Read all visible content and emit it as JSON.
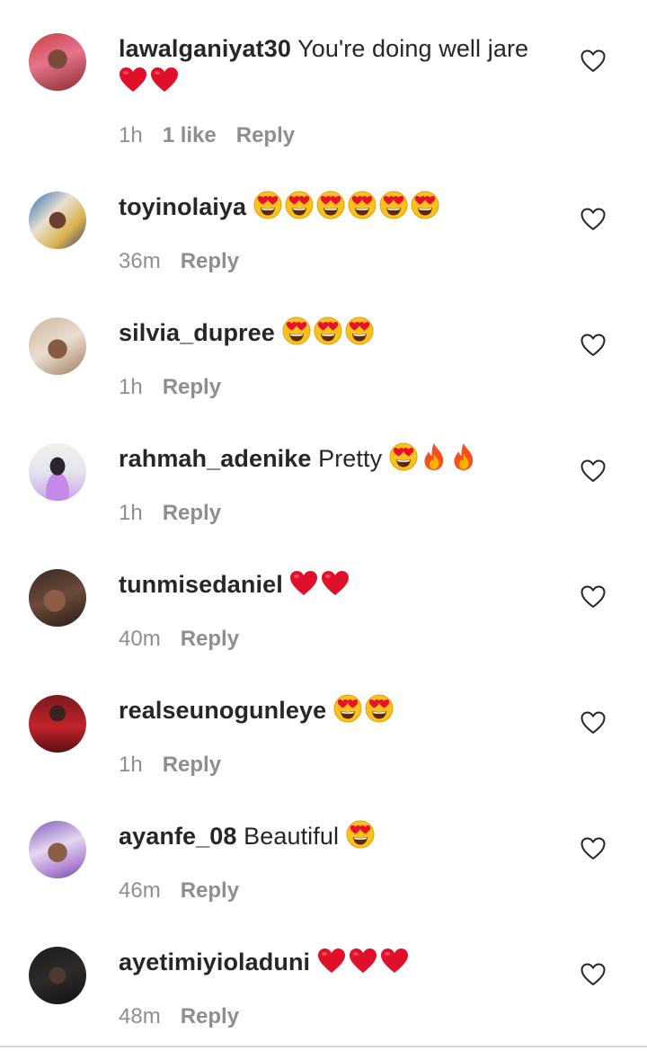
{
  "colors": {
    "text": "#262626",
    "meta": "#8e8e8e",
    "heart": "#e0102a"
  },
  "comments": [
    {
      "username": "lawalganiyat30",
      "text": "You're doing well jare",
      "emojis": [
        "red-heart",
        "red-heart"
      ],
      "time": "1h",
      "likes": "1 like",
      "reply": "Reply"
    },
    {
      "username": "toyinolaiya",
      "text": "",
      "emojis": [
        "heart-eyes",
        "heart-eyes",
        "heart-eyes",
        "heart-eyes",
        "heart-eyes",
        "heart-eyes"
      ],
      "time": "36m",
      "reply": "Reply"
    },
    {
      "username": "silvia_dupree",
      "text": "",
      "emojis": [
        "heart-eyes",
        "heart-eyes",
        "heart-eyes"
      ],
      "time": "1h",
      "reply": "Reply"
    },
    {
      "username": "rahmah_adenike",
      "text": "Pretty",
      "emojis": [
        "heart-eyes",
        "fire",
        "fire"
      ],
      "time": "1h",
      "reply": "Reply"
    },
    {
      "username": "tunmisedaniel",
      "text": "",
      "emojis": [
        "red-heart",
        "red-heart"
      ],
      "time": "40m",
      "reply": "Reply"
    },
    {
      "username": "realseunogunleye",
      "text": "",
      "emojis": [
        "heart-eyes",
        "heart-eyes"
      ],
      "time": "1h",
      "reply": "Reply"
    },
    {
      "username": "ayanfe_08",
      "text": "Beautiful",
      "emojis": [
        "heart-eyes"
      ],
      "time": "46m",
      "reply": "Reply"
    },
    {
      "username": "ayetimiyioladuni",
      "text": "",
      "emojis": [
        "red-heart",
        "red-heart",
        "red-heart"
      ],
      "time": "48m",
      "reply": "Reply"
    }
  ]
}
